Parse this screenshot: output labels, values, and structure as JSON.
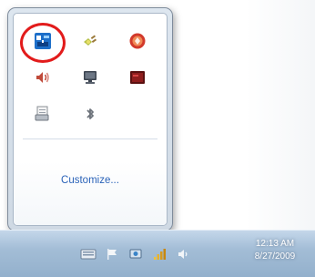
{
  "overflow_panel": {
    "icons": [
      {
        "name": "network-adapter-icon",
        "highlighted": true
      },
      {
        "name": "power-plug-icon",
        "highlighted": false
      },
      {
        "name": "red-round-app-icon",
        "highlighted": false
      },
      {
        "name": "speaker-volume-icon",
        "highlighted": false
      },
      {
        "name": "monitor-display-icon",
        "highlighted": false
      },
      {
        "name": "dark-red-app-icon",
        "highlighted": false
      },
      {
        "name": "document-printer-icon",
        "highlighted": false
      },
      {
        "name": "bluetooth-icon",
        "highlighted": false
      }
    ],
    "customize_label": "Customize..."
  },
  "taskbar": {
    "tray_icons": [
      "keyboard-icon",
      "action-flag-icon",
      "display-settings-icon",
      "network-bars-icon",
      "volume-icon"
    ],
    "clock": {
      "time": "12:13 AM",
      "date": "8/27/2009"
    }
  },
  "colors": {
    "highlight_ring": "#e21b1b",
    "link": "#2a63b8",
    "taskbar": "#a3bdd6"
  }
}
